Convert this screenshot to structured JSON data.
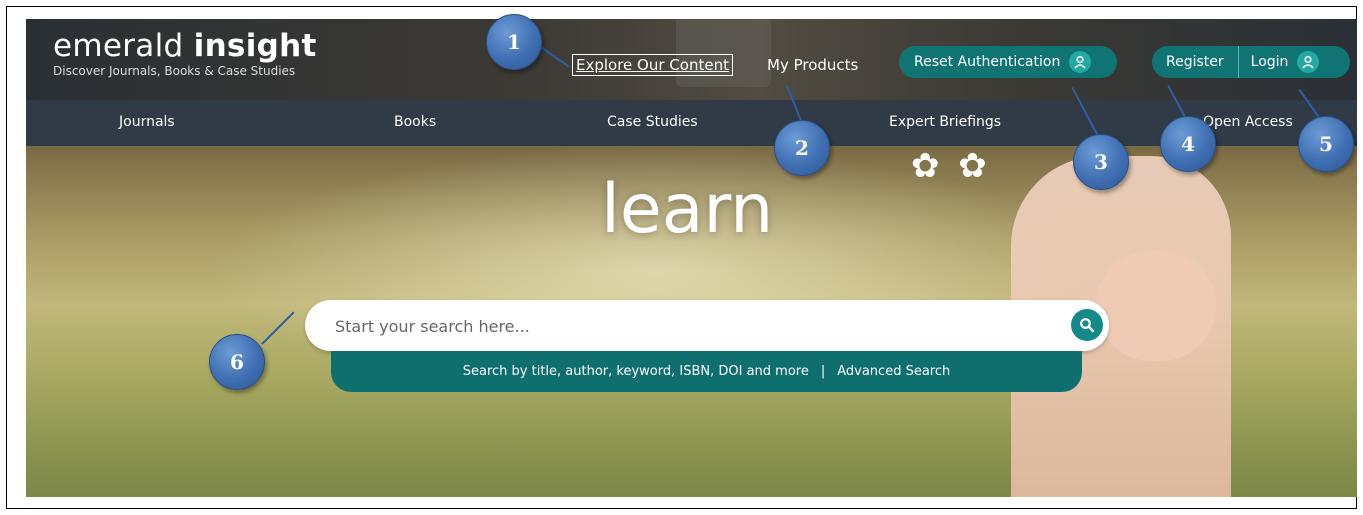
{
  "header": {
    "logo_text_light": "emerald",
    "logo_text_bold": "insight",
    "logo_tagline": "Discover Journals, Books & Case Studies",
    "explore_link": "Explore Our Content",
    "my_products_link": "My Products",
    "reset_auth_button": "Reset Authentication",
    "register_button": "Register",
    "login_button": "Login"
  },
  "nav": {
    "items": [
      "Journals",
      "Books",
      "Case Studies",
      "Expert Briefings",
      "Open Access"
    ]
  },
  "hero": {
    "headline": "learn",
    "search_placeholder": "Start your search here...",
    "search_hint": "Search by title, author, keyword, ISBN, DOI and more",
    "hint_separator": "|",
    "advanced_search_link": "Advanced Search"
  },
  "callouts": [
    "1",
    "2",
    "3",
    "4",
    "5",
    "6"
  ],
  "colors": {
    "teal_button": "#0f7473",
    "nav_bar": "#303b47",
    "callout_blue": "#3f6fb2"
  },
  "icons": {
    "account": "user-icon",
    "search": "search-icon"
  }
}
